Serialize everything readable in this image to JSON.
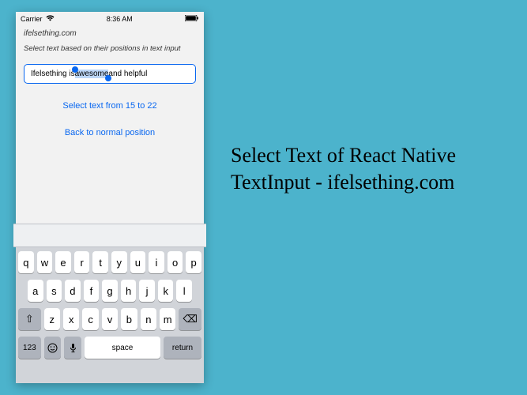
{
  "status": {
    "carrier": "Carrier",
    "time": "8:36 AM"
  },
  "app": {
    "site": "ifelsething.com",
    "instruction": "Select text based on their positions in text input",
    "input": {
      "before": "Ifelsething is ",
      "selected": "awesome",
      "after": " and helpful"
    },
    "link1": "Select text from 15 to 22",
    "link2": "Back to normal position"
  },
  "keyboard": {
    "row1": [
      "q",
      "w",
      "e",
      "r",
      "t",
      "y",
      "u",
      "i",
      "o",
      "p"
    ],
    "row2": [
      "a",
      "s",
      "d",
      "f",
      "g",
      "h",
      "j",
      "k",
      "l"
    ],
    "row3": [
      "z",
      "x",
      "c",
      "v",
      "b",
      "n",
      "m"
    ],
    "shift": "⇧",
    "backspace": "⌫",
    "numbers": "123",
    "emoji": "☺",
    "mic": "🎤",
    "space": "space",
    "return": "return"
  },
  "title": "Select Text of React Native TextInput - ifelsething.com"
}
